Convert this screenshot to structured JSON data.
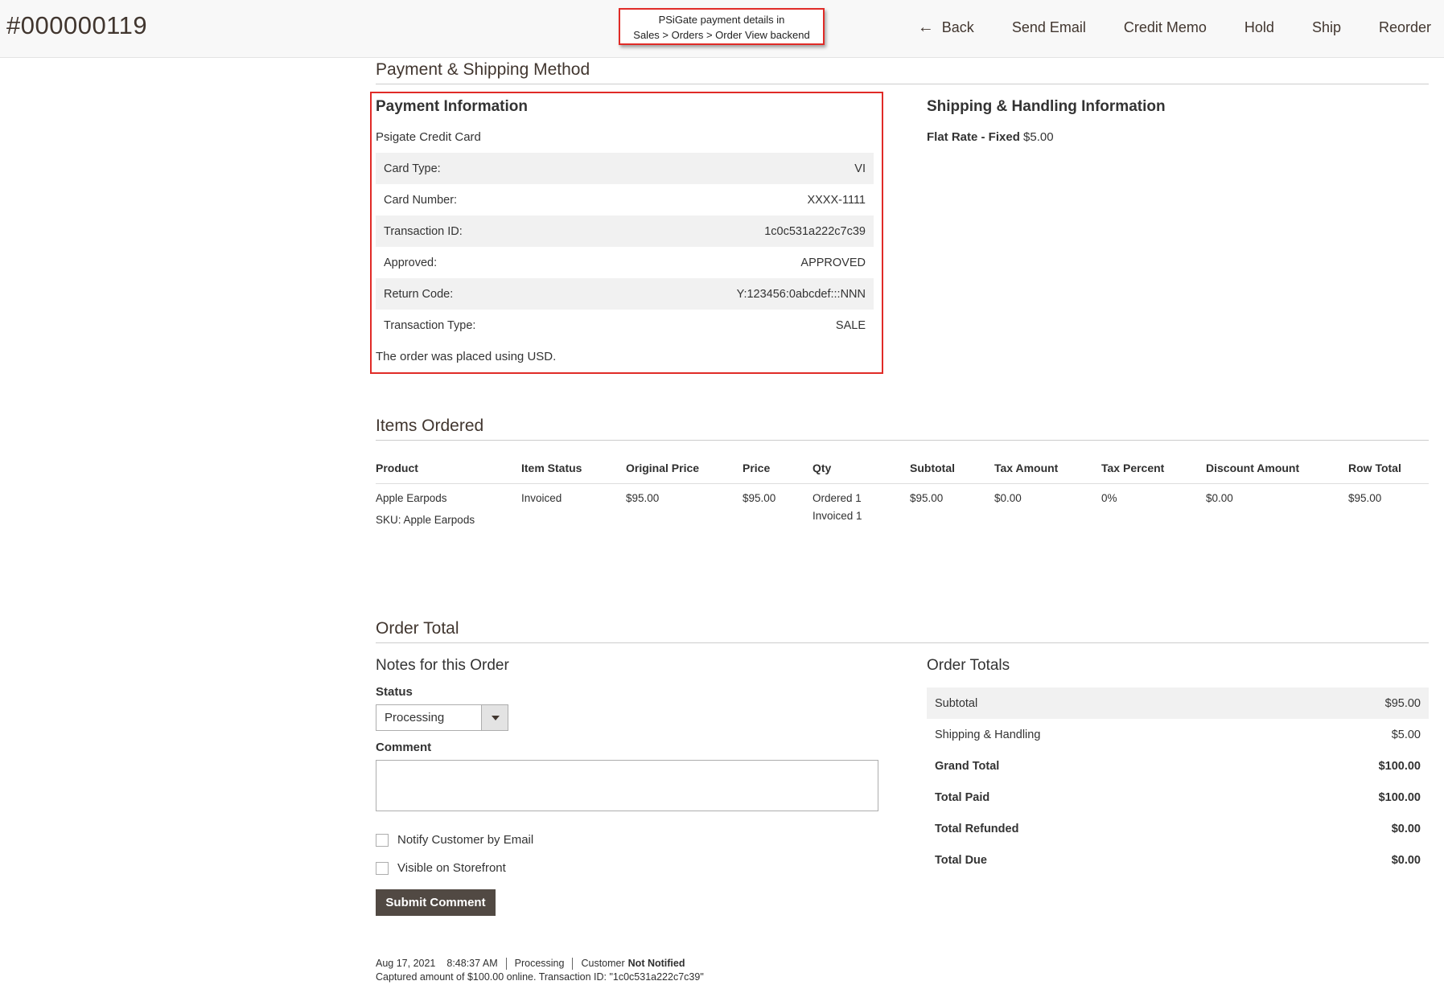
{
  "header": {
    "order_number": "#000000119",
    "callout_line1": "PSiGate payment details in",
    "callout_line2": "Sales > Orders > Order View backend",
    "actions": {
      "back": "Back",
      "send_email": "Send Email",
      "credit_memo": "Credit Memo",
      "hold": "Hold",
      "ship": "Ship",
      "reorder": "Reorder"
    }
  },
  "payment_shipping": {
    "section_title": "Payment & Shipping Method",
    "payment_title": "Payment Information",
    "payment_method": "Psigate Credit Card",
    "rows": [
      {
        "label": "Card Type:",
        "value": "VI"
      },
      {
        "label": "Card Number:",
        "value": "XXXX-1111"
      },
      {
        "label": "Transaction ID:",
        "value": "1c0c531a222c7c39"
      },
      {
        "label": "Approved:",
        "value": "APPROVED"
      },
      {
        "label": "Return Code:",
        "value": "Y:123456:0abcdef:::NNN"
      },
      {
        "label": "Transaction Type:",
        "value": "SALE"
      }
    ],
    "currency_note": "The order was placed using USD.",
    "shipping_title": "Shipping & Handling Information",
    "shipping_method": "Flat Rate - Fixed",
    "shipping_price": "$5.00"
  },
  "items": {
    "section_title": "Items Ordered",
    "columns": [
      "Product",
      "Item Status",
      "Original Price",
      "Price",
      "Qty",
      "Subtotal",
      "Tax Amount",
      "Tax Percent",
      "Discount Amount",
      "Row Total"
    ],
    "row": {
      "product": "Apple Earpods",
      "sku": "SKU: Apple Earpods",
      "status": "Invoiced",
      "original_price": "$95.00",
      "price": "$95.00",
      "qty_ordered": "Ordered 1",
      "qty_invoiced": "Invoiced 1",
      "subtotal": "$95.00",
      "tax_amount": "$0.00",
      "tax_percent": "0%",
      "discount": "$0.00",
      "row_total": "$95.00"
    }
  },
  "order_total": {
    "section_title": "Order Total",
    "notes_title": "Notes for this Order",
    "status_label": "Status",
    "status_value": "Processing",
    "comment_label": "Comment",
    "notify_label": "Notify Customer by Email",
    "visible_label": "Visible on Storefront",
    "submit_label": "Submit Comment",
    "history": {
      "date": "Aug 17, 2021",
      "time": "8:48:37 AM",
      "status": "Processing",
      "customer_prefix": "Customer",
      "customer_state": "Not Notified",
      "message": "Captured amount of $100.00 online. Transaction ID: \"1c0c531a222c7c39\""
    },
    "totals_title": "Order Totals",
    "totals": [
      {
        "label": "Subtotal",
        "value": "$95.00"
      },
      {
        "label": "Shipping & Handling",
        "value": "$5.00"
      },
      {
        "label": "Grand Total",
        "value": "$100.00"
      },
      {
        "label": "Total Paid",
        "value": "$100.00"
      },
      {
        "label": "Total Refunded",
        "value": "$0.00"
      },
      {
        "label": "Total Due",
        "value": "$0.00"
      }
    ]
  }
}
